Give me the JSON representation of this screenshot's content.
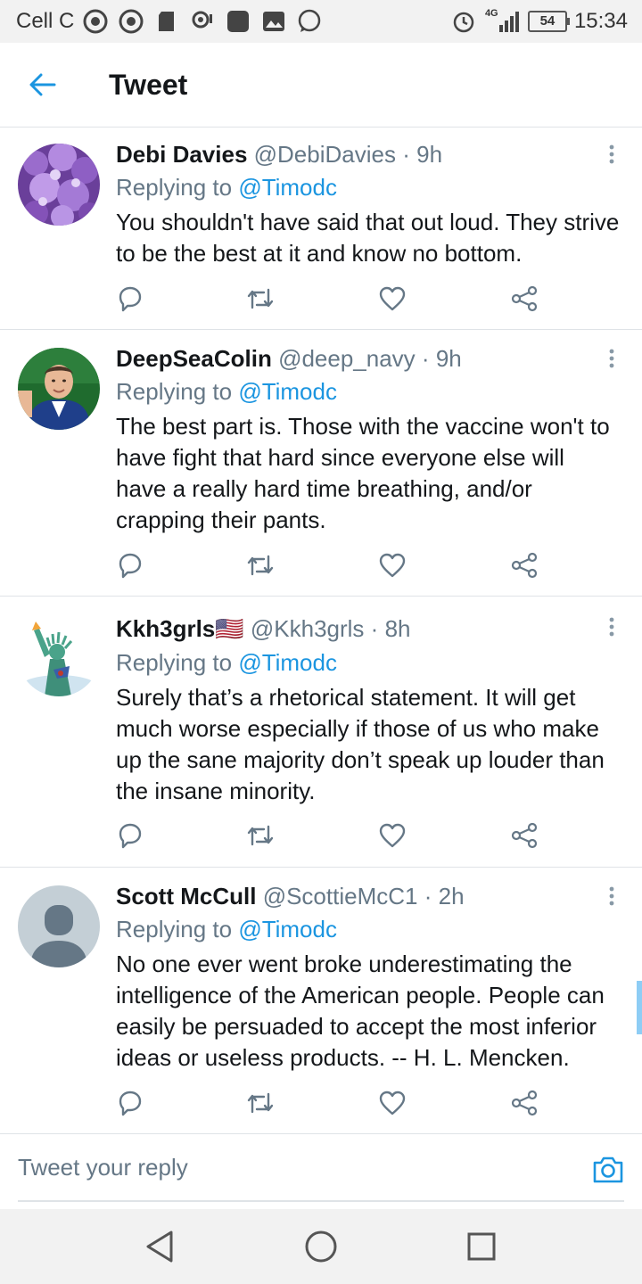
{
  "status_bar": {
    "carrier": "Cell C",
    "network": "4G",
    "battery": "54",
    "time": "15:34"
  },
  "header": {
    "title": "Tweet"
  },
  "colors": {
    "accent": "#1b95e0",
    "secondary_text": "#657786",
    "divider": "#dfe3e7"
  },
  "replying_label": "Replying to",
  "tweets": [
    {
      "name": "Debi Davies",
      "handle": "@DebiDavies",
      "separator": "·",
      "time": "9h",
      "reply_to": "@Timodc",
      "text": "You shouldn't have said that out loud. They strive to be the best at it and know no bottom."
    },
    {
      "name": "DeepSeaColin",
      "handle": "@deep_navy",
      "separator": "·",
      "time": "9h",
      "reply_to": "@Timodc",
      "text": "The best part is. Those with the vaccine won't to have fight that hard since everyone else will have a really hard time breathing, and/or crapping their pants."
    },
    {
      "name": "Kkh3grls🇺🇸",
      "handle": "@Kkh3grls",
      "separator": "·",
      "time": "8h",
      "reply_to": "@Timodc",
      "text": "Surely that’s a rhetorical statement. It will get much worse especially if those of us who make up the sane majority don’t speak up louder than the insane minority."
    },
    {
      "name": "Scott McCull",
      "handle": "@ScottieMcC1",
      "separator": "·",
      "time": "2h",
      "reply_to": "@Timodc",
      "text": "No one ever went broke underestimating the intelligence of the American people. People can easily be persuaded to accept the most inferior ideas or useless products. -- H. L. Mencken."
    }
  ],
  "reply_bar": {
    "placeholder": "Tweet your reply"
  },
  "icons": {
    "back": "arrow-left-icon",
    "more": "more-vertical-icon",
    "reply": "reply-icon",
    "retweet": "retweet-icon",
    "like": "heart-icon",
    "share": "share-icon",
    "camera": "camera-icon",
    "nav_back": "triangle-back-icon",
    "nav_home": "circle-home-icon",
    "nav_recent": "square-recent-icon"
  }
}
